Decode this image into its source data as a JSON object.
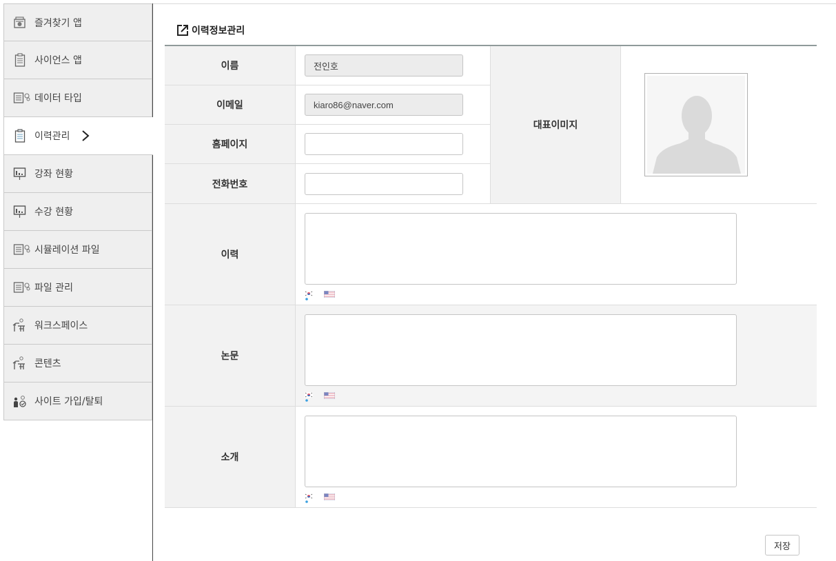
{
  "sidebar": {
    "items": [
      {
        "label": "즐겨찾기 앱",
        "icon": "favorites-app-icon"
      },
      {
        "label": "사이언스 앱",
        "icon": "clipboard-icon"
      },
      {
        "label": "데이터 타입",
        "icon": "document-gear-icon"
      },
      {
        "label": "이력관리",
        "icon": "clipboard-icon",
        "active": true
      },
      {
        "label": "강좌 현황",
        "icon": "board-chart-icon"
      },
      {
        "label": "수강 현황",
        "icon": "board-chart-icon"
      },
      {
        "label": "시뮬레이션 파일",
        "icon": "document-gear-icon"
      },
      {
        "label": "파일 관리",
        "icon": "document-gear-icon"
      },
      {
        "label": "워크스페이스",
        "icon": "workspace-person-icon"
      },
      {
        "label": "콘텐츠",
        "icon": "workspace-person-icon"
      },
      {
        "label": "사이트 가입/탈퇴",
        "icon": "user-join-icon"
      }
    ]
  },
  "page": {
    "title": "이력정보관리",
    "title_icon": "external-link-icon"
  },
  "form": {
    "name_label": "이름",
    "name_value": "전인호",
    "email_label": "이메일",
    "email_value": "kiaro86@naver.com",
    "homepage_label": "홈페이지",
    "homepage_value": "",
    "phone_label": "전화번호",
    "phone_value": "",
    "rep_image_label": "대표이미지",
    "history_label": "이력",
    "paper_label": "논문",
    "intro_label": "소개"
  },
  "actions": {
    "save_label": "저장"
  },
  "colors": {
    "sidebar_bg": "#efefef",
    "label_bg": "#f2f2f2",
    "header_rule": "#8f9a9a",
    "readonly_bg": "#ececec"
  }
}
